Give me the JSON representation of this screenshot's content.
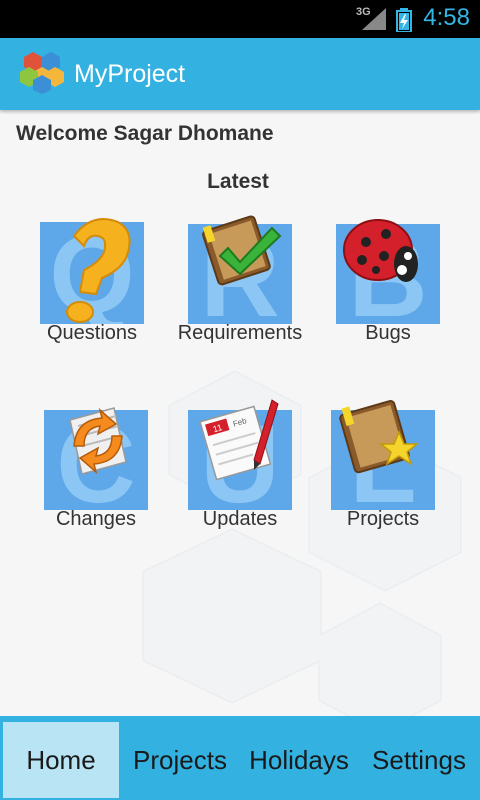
{
  "status_bar": {
    "network": "3G",
    "time": "4:58",
    "clock_color": "#33b5e5"
  },
  "app_bar": {
    "title": "MyProject",
    "logo_icon": "hexagon-cluster-logo-icon",
    "color": "#33b2e2"
  },
  "main": {
    "welcome": "Welcome Sagar Dhomane",
    "section_title": "Latest",
    "tiles": [
      {
        "label": "Questions",
        "icon": "question-mark-icon"
      },
      {
        "label": "Requirements",
        "icon": "notebook-check-icon"
      },
      {
        "label": "Bugs",
        "icon": "ladybug-icon"
      },
      {
        "label": "Changes",
        "icon": "sync-document-icon"
      },
      {
        "label": "Updates",
        "icon": "calendar-pen-icon"
      },
      {
        "label": "Projects",
        "icon": "notebook-star-icon"
      }
    ]
  },
  "bottom_nav": {
    "items": [
      {
        "label": "Home",
        "active": true
      },
      {
        "label": "Projects",
        "active": false
      },
      {
        "label": "Holidays",
        "active": false
      },
      {
        "label": "Settings",
        "active": false
      }
    ],
    "active_color": "#b8e4f4"
  }
}
